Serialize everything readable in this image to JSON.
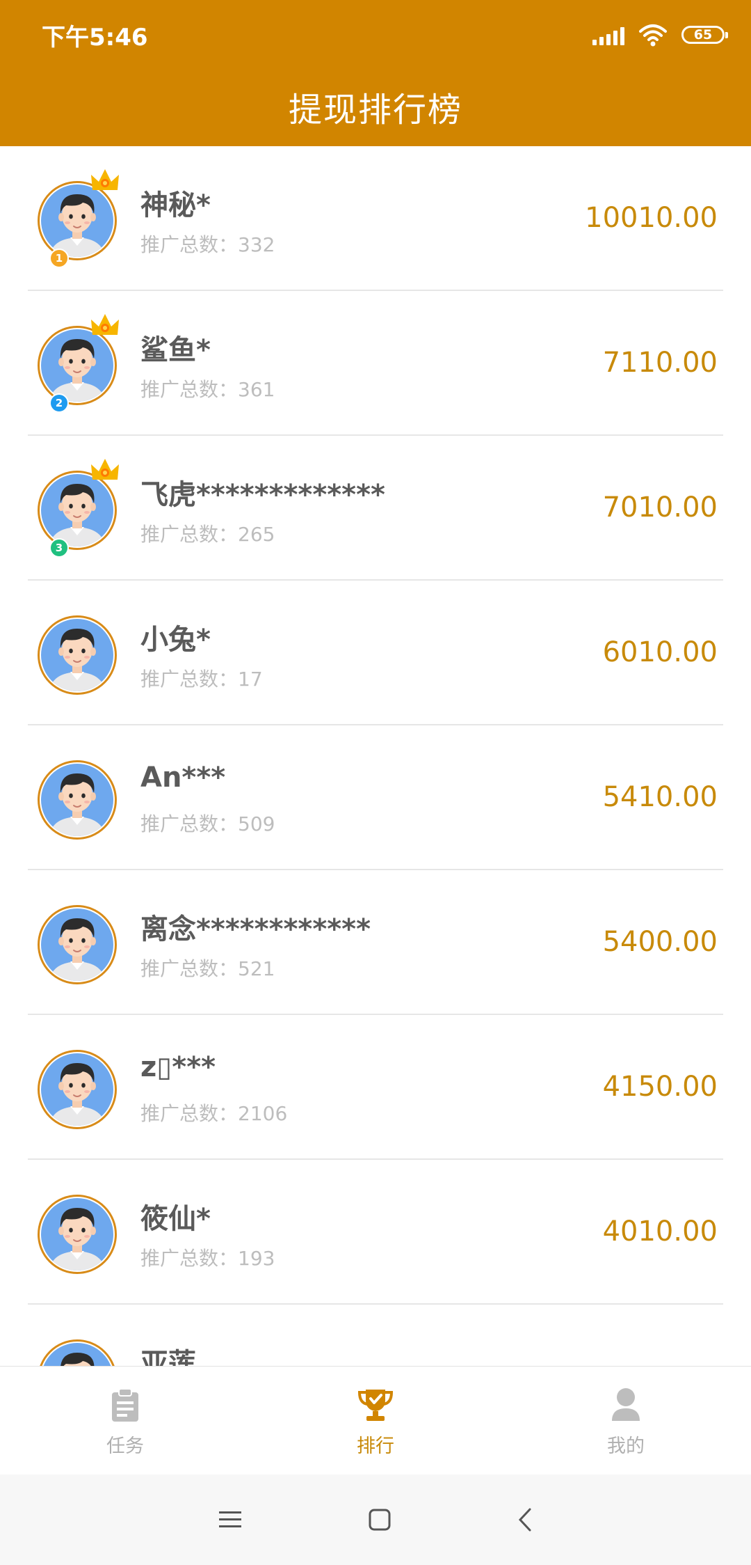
{
  "status_bar": {
    "time": "下午5:46",
    "battery": "65"
  },
  "header": {
    "title": "提现排行榜"
  },
  "list": [
    {
      "name": "神秘*",
      "promo_label": "推广总数：",
      "promo_count": "332",
      "amount": "10010.00",
      "rank": "1"
    },
    {
      "name": "鲨鱼*",
      "promo_label": "推广总数：",
      "promo_count": "361",
      "amount": "7110.00",
      "rank": "2"
    },
    {
      "name": "飞虎*************",
      "promo_label": "推广总数：",
      "promo_count": "265",
      "amount": "7010.00",
      "rank": "3"
    },
    {
      "name": "小兔*",
      "promo_label": "推广总数：",
      "promo_count": "17",
      "amount": "6010.00"
    },
    {
      "name": "An***",
      "promo_label": "推广总数：",
      "promo_count": "509",
      "amount": "5410.00"
    },
    {
      "name": "离念************",
      "promo_label": "推广总数：",
      "promo_count": "521",
      "amount": "5400.00"
    },
    {
      "name": "z▯***",
      "promo_label": "推广总数：",
      "promo_count": "2106",
      "amount": "4150.00"
    },
    {
      "name": "筱仙*",
      "promo_label": "推广总数：",
      "promo_count": "193",
      "amount": "4010.00"
    },
    {
      "name": "亚莲",
      "promo_label": "",
      "promo_count": "",
      "amount": ""
    }
  ],
  "tabs": [
    {
      "label": "任务",
      "icon": "clipboard-icon"
    },
    {
      "label": "排行",
      "icon": "trophy-icon",
      "active": true
    },
    {
      "label": "我的",
      "icon": "person-icon"
    }
  ],
  "colors": {
    "header_bg": "#D18500",
    "accent": "#C88A0A",
    "rank1": "#F5A623",
    "rank2": "#1E9BF0",
    "rank3": "#20C080"
  }
}
